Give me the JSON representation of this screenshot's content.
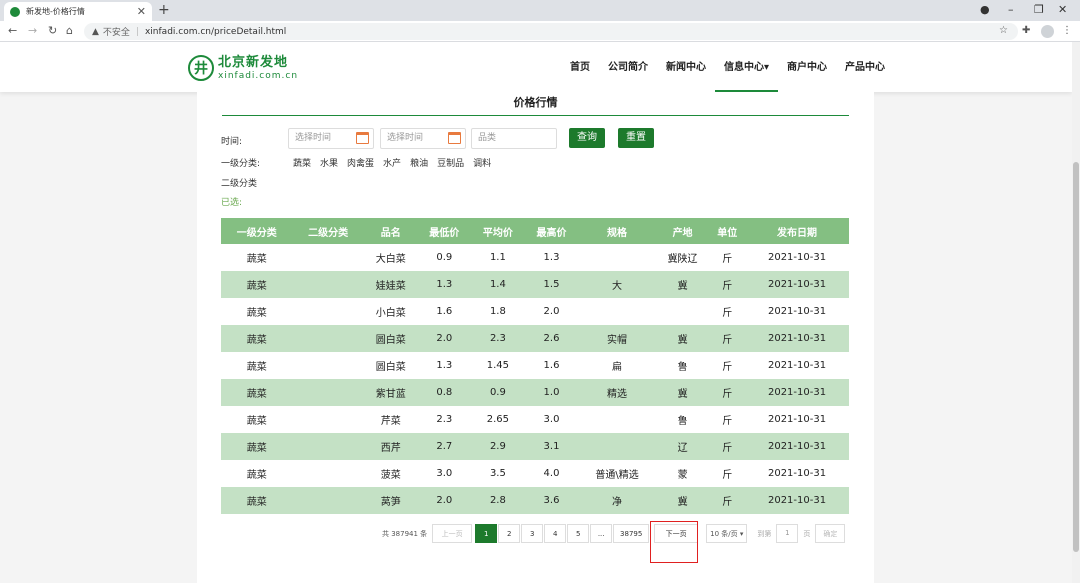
{
  "browser": {
    "tab_title": "新发地-价格行情",
    "tab_close": "✕",
    "new_tab": "+",
    "insecure_label": "不安全",
    "url": "xinfadi.com.cn/priceDetail.html"
  },
  "site": {
    "logo_cn": "北京新发地",
    "logo_en": "xinfadi.com.cn",
    "nav": [
      "首页",
      "公司简介",
      "新闻中心",
      "信息中心▾",
      "商户中心",
      "产品中心"
    ]
  },
  "filters": {
    "title": "价格行情",
    "time_label": "时间:",
    "date_placeholder": "选择时间",
    "category_placeholder": "品类",
    "query_button": "查询",
    "reset_button": "重置",
    "level1_label": "一级分类:",
    "level1_options": [
      "蔬菜",
      "水果",
      "肉禽蛋",
      "水产",
      "粮油",
      "豆制品",
      "调料"
    ],
    "level2_label": "二级分类",
    "selected_label": "已选:"
  },
  "table": {
    "headers": [
      "一级分类",
      "二级分类",
      "品名",
      "最低价",
      "平均价",
      "最高价",
      "规格",
      "产地",
      "单位",
      "发布日期"
    ],
    "rows": [
      [
        "蔬菜",
        "",
        "大白菜",
        "0.9",
        "1.1",
        "1.3",
        "",
        "冀陕辽",
        "斤",
        "2021-10-31"
      ],
      [
        "蔬菜",
        "",
        "娃娃菜",
        "1.3",
        "1.4",
        "1.5",
        "大",
        "冀",
        "斤",
        "2021-10-31"
      ],
      [
        "蔬菜",
        "",
        "小白菜",
        "1.6",
        "1.8",
        "2.0",
        "",
        "",
        "斤",
        "2021-10-31"
      ],
      [
        "蔬菜",
        "",
        "圆白菜",
        "2.0",
        "2.3",
        "2.6",
        "实帽",
        "冀",
        "斤",
        "2021-10-31"
      ],
      [
        "蔬菜",
        "",
        "圆白菜",
        "1.3",
        "1.45",
        "1.6",
        "扁",
        "鲁",
        "斤",
        "2021-10-31"
      ],
      [
        "蔬菜",
        "",
        "紫甘蓝",
        "0.8",
        "0.9",
        "1.0",
        "精选",
        "冀",
        "斤",
        "2021-10-31"
      ],
      [
        "蔬菜",
        "",
        "芹菜",
        "2.3",
        "2.65",
        "3.0",
        "",
        "鲁",
        "斤",
        "2021-10-31"
      ],
      [
        "蔬菜",
        "",
        "西芹",
        "2.7",
        "2.9",
        "3.1",
        "",
        "辽",
        "斤",
        "2021-10-31"
      ],
      [
        "蔬菜",
        "",
        "菠菜",
        "3.0",
        "3.5",
        "4.0",
        "普通\\精选",
        "蒙",
        "斤",
        "2021-10-31"
      ],
      [
        "蔬菜",
        "",
        "莴笋",
        "2.0",
        "2.8",
        "3.6",
        "净",
        "冀",
        "斤",
        "2021-10-31"
      ]
    ]
  },
  "pagination": {
    "total": "共 387941 条",
    "prev": "上一页",
    "pages": [
      "1",
      "2",
      "3",
      "4",
      "5",
      "...",
      "38795"
    ],
    "current": "1",
    "next": "下一页",
    "page_size": "10 条/页 ▾",
    "goto_label": "到第",
    "goto_value": "1",
    "page_unit": "页",
    "confirm": "确定"
  },
  "colors": {
    "brand_green": "#1d7a2c",
    "table_header": "#84bf82",
    "row_stripe": "#c4e1c5",
    "highlight_box": "#e02020"
  }
}
